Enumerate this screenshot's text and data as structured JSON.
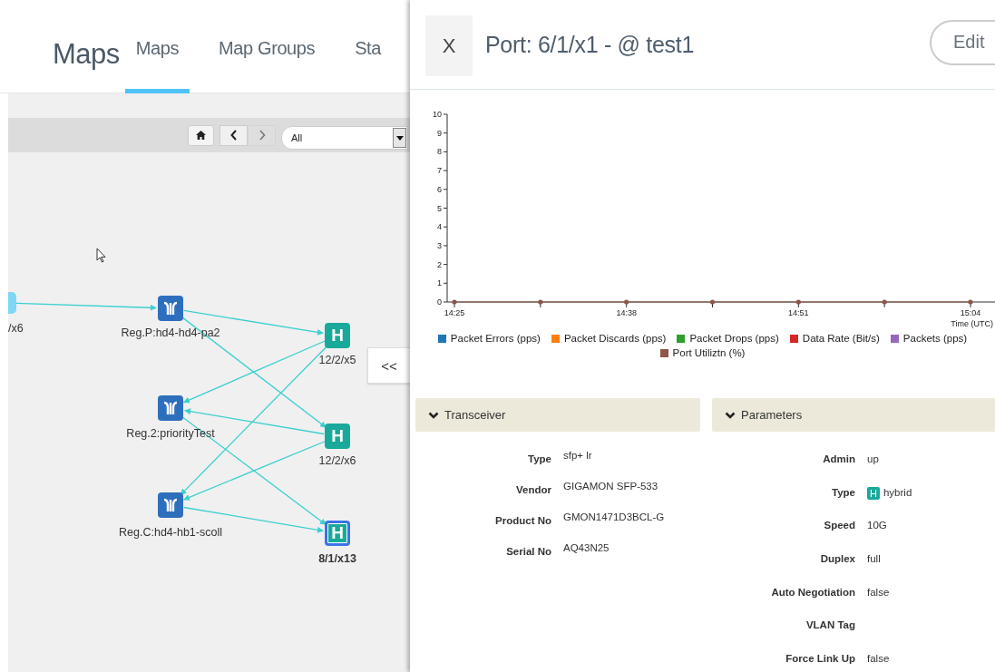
{
  "header": {
    "title": "Maps",
    "tabs": [
      {
        "label": "Maps",
        "selected": true
      },
      {
        "label": "Map Groups",
        "selected": false
      },
      {
        "label": "Sta",
        "selected": false
      }
    ]
  },
  "map": {
    "toolbar": {
      "filter": {
        "value": "All"
      }
    },
    "nodes": [
      {
        "kind": "partial",
        "label": "/x6",
        "selected": false
      },
      {
        "kind": "regex",
        "label": "Reg.P:hd4-hd4-pa2",
        "selected": false
      },
      {
        "kind": "regex",
        "label": "Reg.2:priorityTest",
        "selected": false
      },
      {
        "kind": "regex",
        "label": "Reg.C:hd4-hb1-scoll",
        "selected": false
      },
      {
        "kind": "hybrid",
        "icon_text": "H",
        "label": "12/2/x5",
        "selected": false
      },
      {
        "kind": "hybrid",
        "icon_text": "H",
        "label": "12/2/x6",
        "selected": false
      },
      {
        "kind": "hybrid",
        "icon_text": "H",
        "label": "8/1/x13",
        "selected": true
      }
    ],
    "collapse_button": "<<"
  },
  "panel": {
    "close_button": "X",
    "title": "Port: 6/1/x1 - @ test1",
    "edit_button": "Edit",
    "chart_data": {
      "type": "line",
      "xlabel": "Time (UTC)",
      "categories": [
        "14:25",
        null,
        "14:38",
        null,
        "14:51",
        null,
        "15:04"
      ],
      "legend": "bottom",
      "ylim": [
        0,
        10
      ],
      "yticks": [
        0,
        1,
        2,
        3,
        4,
        5,
        6,
        7,
        8,
        9,
        10
      ],
      "series": [
        {
          "name": "Packet Errors (pps)",
          "color": "#1f77b4",
          "values": [
            null,
            null,
            null,
            null,
            null,
            null,
            null
          ]
        },
        {
          "name": "Packet Discards (pps)",
          "color": "#ff7f0e",
          "values": [
            null,
            null,
            null,
            null,
            null,
            null,
            null
          ]
        },
        {
          "name": "Packet Drops (pps)",
          "color": "#2ca02c",
          "values": [
            null,
            null,
            null,
            null,
            null,
            null,
            null
          ]
        },
        {
          "name": "Data Rate (Bit/s)",
          "color": "#d62728",
          "values": [
            null,
            null,
            null,
            null,
            null,
            null,
            null
          ]
        },
        {
          "name": "Packets (pps)",
          "color": "#9467bd",
          "values": [
            null,
            null,
            null,
            null,
            null,
            null,
            null
          ]
        },
        {
          "name": "Port Utiliztn (%)",
          "color": "#8c564b",
          "values": [
            0,
            0,
            0,
            0,
            0,
            0,
            0
          ]
        }
      ]
    },
    "sections": [
      {
        "title": "Transceiver",
        "expanded": true,
        "rows": [
          {
            "label": "Type",
            "value": "sfp+ lr"
          },
          {
            "label": "Vendor",
            "value": "GIGAMON SFP-533"
          },
          {
            "label": "Product No",
            "value": "GMON1471D3BCL-G"
          },
          {
            "label": "Serial No",
            "value": "AQ43N25"
          }
        ]
      },
      {
        "title": "Parameters",
        "expanded": true,
        "rows": [
          {
            "label": "Admin",
            "value": "up"
          },
          {
            "label": "Type",
            "badge": "H",
            "value": "hybrid"
          },
          {
            "label": "Speed",
            "value": "10G"
          },
          {
            "label": "Duplex",
            "value": "full"
          },
          {
            "label": "Auto Negotiation",
            "value": "false"
          },
          {
            "label": "VLAN Tag"
          },
          {
            "label": "Force Link Up",
            "value": "false"
          }
        ]
      }
    ]
  }
}
